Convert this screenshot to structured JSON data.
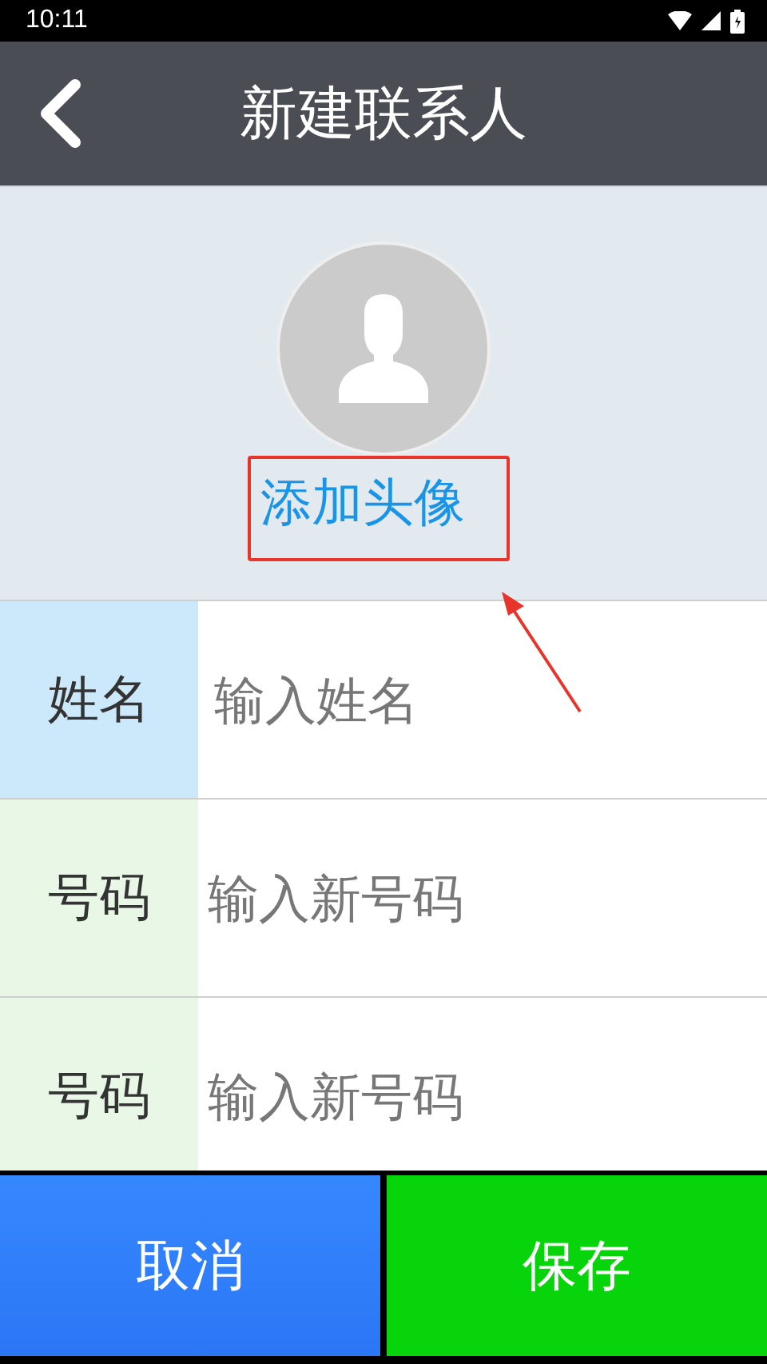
{
  "status_bar": {
    "time": "10:11"
  },
  "header": {
    "title": "新建联系人"
  },
  "avatar": {
    "label": "添加头像",
    "annotated": true
  },
  "fields": [
    {
      "label": "姓名",
      "placeholder": "输入姓名",
      "selected": true
    },
    {
      "label": "号码",
      "placeholder": "输入新号码",
      "selected": false
    },
    {
      "label": "号码",
      "placeholder": "输入新号码",
      "selected": false
    }
  ],
  "buttons": [
    {
      "label": "取消",
      "kind": "cancel"
    },
    {
      "label": "保存",
      "kind": "save"
    }
  ]
}
